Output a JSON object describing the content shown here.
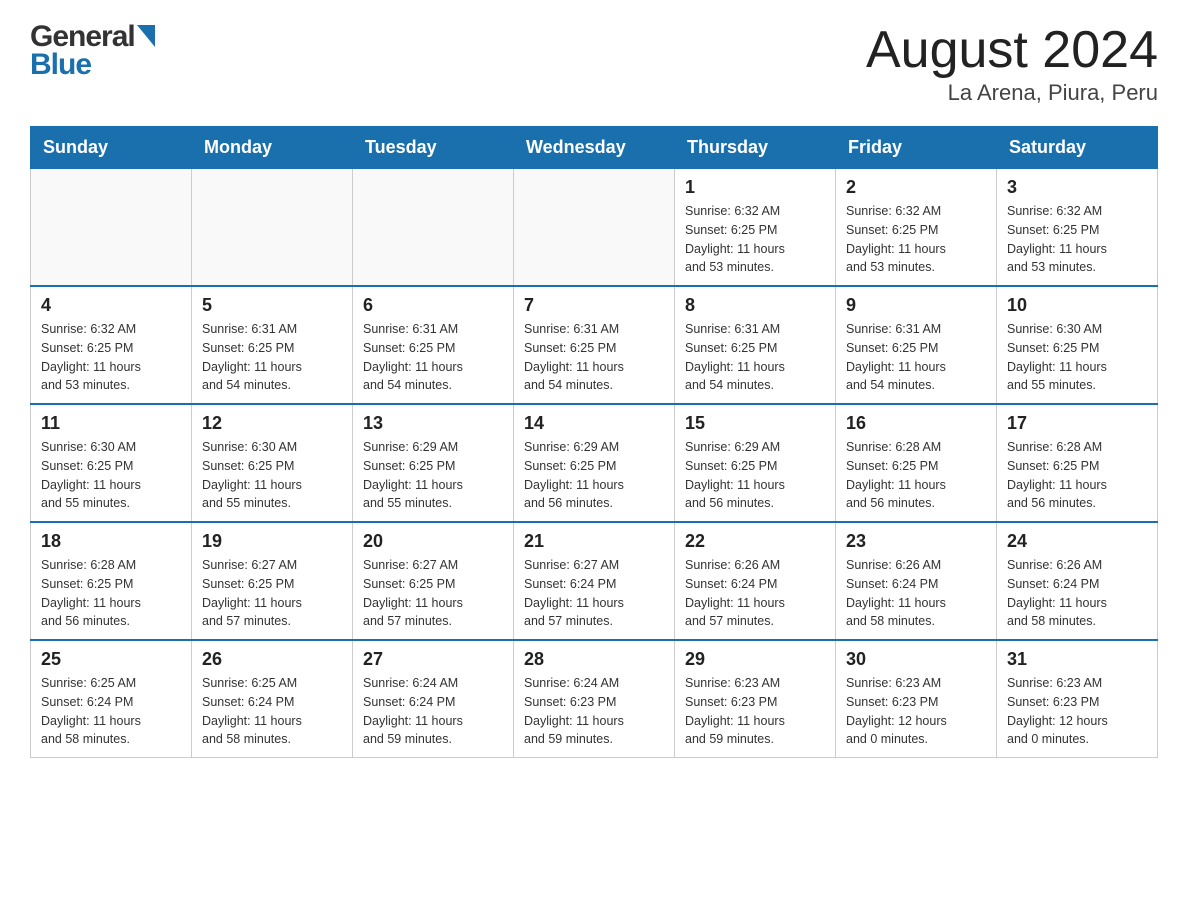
{
  "header": {
    "logo": {
      "general": "General",
      "blue": "Blue"
    },
    "title": "August 2024",
    "subtitle": "La Arena, Piura, Peru"
  },
  "days_of_week": [
    "Sunday",
    "Monday",
    "Tuesday",
    "Wednesday",
    "Thursday",
    "Friday",
    "Saturday"
  ],
  "weeks": [
    {
      "days": [
        {
          "number": "",
          "info": ""
        },
        {
          "number": "",
          "info": ""
        },
        {
          "number": "",
          "info": ""
        },
        {
          "number": "",
          "info": ""
        },
        {
          "number": "1",
          "info": "Sunrise: 6:32 AM\nSunset: 6:25 PM\nDaylight: 11 hours\nand 53 minutes."
        },
        {
          "number": "2",
          "info": "Sunrise: 6:32 AM\nSunset: 6:25 PM\nDaylight: 11 hours\nand 53 minutes."
        },
        {
          "number": "3",
          "info": "Sunrise: 6:32 AM\nSunset: 6:25 PM\nDaylight: 11 hours\nand 53 minutes."
        }
      ]
    },
    {
      "days": [
        {
          "number": "4",
          "info": "Sunrise: 6:32 AM\nSunset: 6:25 PM\nDaylight: 11 hours\nand 53 minutes."
        },
        {
          "number": "5",
          "info": "Sunrise: 6:31 AM\nSunset: 6:25 PM\nDaylight: 11 hours\nand 54 minutes."
        },
        {
          "number": "6",
          "info": "Sunrise: 6:31 AM\nSunset: 6:25 PM\nDaylight: 11 hours\nand 54 minutes."
        },
        {
          "number": "7",
          "info": "Sunrise: 6:31 AM\nSunset: 6:25 PM\nDaylight: 11 hours\nand 54 minutes."
        },
        {
          "number": "8",
          "info": "Sunrise: 6:31 AM\nSunset: 6:25 PM\nDaylight: 11 hours\nand 54 minutes."
        },
        {
          "number": "9",
          "info": "Sunrise: 6:31 AM\nSunset: 6:25 PM\nDaylight: 11 hours\nand 54 minutes."
        },
        {
          "number": "10",
          "info": "Sunrise: 6:30 AM\nSunset: 6:25 PM\nDaylight: 11 hours\nand 55 minutes."
        }
      ]
    },
    {
      "days": [
        {
          "number": "11",
          "info": "Sunrise: 6:30 AM\nSunset: 6:25 PM\nDaylight: 11 hours\nand 55 minutes."
        },
        {
          "number": "12",
          "info": "Sunrise: 6:30 AM\nSunset: 6:25 PM\nDaylight: 11 hours\nand 55 minutes."
        },
        {
          "number": "13",
          "info": "Sunrise: 6:29 AM\nSunset: 6:25 PM\nDaylight: 11 hours\nand 55 minutes."
        },
        {
          "number": "14",
          "info": "Sunrise: 6:29 AM\nSunset: 6:25 PM\nDaylight: 11 hours\nand 56 minutes."
        },
        {
          "number": "15",
          "info": "Sunrise: 6:29 AM\nSunset: 6:25 PM\nDaylight: 11 hours\nand 56 minutes."
        },
        {
          "number": "16",
          "info": "Sunrise: 6:28 AM\nSunset: 6:25 PM\nDaylight: 11 hours\nand 56 minutes."
        },
        {
          "number": "17",
          "info": "Sunrise: 6:28 AM\nSunset: 6:25 PM\nDaylight: 11 hours\nand 56 minutes."
        }
      ]
    },
    {
      "days": [
        {
          "number": "18",
          "info": "Sunrise: 6:28 AM\nSunset: 6:25 PM\nDaylight: 11 hours\nand 56 minutes."
        },
        {
          "number": "19",
          "info": "Sunrise: 6:27 AM\nSunset: 6:25 PM\nDaylight: 11 hours\nand 57 minutes."
        },
        {
          "number": "20",
          "info": "Sunrise: 6:27 AM\nSunset: 6:25 PM\nDaylight: 11 hours\nand 57 minutes."
        },
        {
          "number": "21",
          "info": "Sunrise: 6:27 AM\nSunset: 6:24 PM\nDaylight: 11 hours\nand 57 minutes."
        },
        {
          "number": "22",
          "info": "Sunrise: 6:26 AM\nSunset: 6:24 PM\nDaylight: 11 hours\nand 57 minutes."
        },
        {
          "number": "23",
          "info": "Sunrise: 6:26 AM\nSunset: 6:24 PM\nDaylight: 11 hours\nand 58 minutes."
        },
        {
          "number": "24",
          "info": "Sunrise: 6:26 AM\nSunset: 6:24 PM\nDaylight: 11 hours\nand 58 minutes."
        }
      ]
    },
    {
      "days": [
        {
          "number": "25",
          "info": "Sunrise: 6:25 AM\nSunset: 6:24 PM\nDaylight: 11 hours\nand 58 minutes."
        },
        {
          "number": "26",
          "info": "Sunrise: 6:25 AM\nSunset: 6:24 PM\nDaylight: 11 hours\nand 58 minutes."
        },
        {
          "number": "27",
          "info": "Sunrise: 6:24 AM\nSunset: 6:24 PM\nDaylight: 11 hours\nand 59 minutes."
        },
        {
          "number": "28",
          "info": "Sunrise: 6:24 AM\nSunset: 6:23 PM\nDaylight: 11 hours\nand 59 minutes."
        },
        {
          "number": "29",
          "info": "Sunrise: 6:23 AM\nSunset: 6:23 PM\nDaylight: 11 hours\nand 59 minutes."
        },
        {
          "number": "30",
          "info": "Sunrise: 6:23 AM\nSunset: 6:23 PM\nDaylight: 12 hours\nand 0 minutes."
        },
        {
          "number": "31",
          "info": "Sunrise: 6:23 AM\nSunset: 6:23 PM\nDaylight: 12 hours\nand 0 minutes."
        }
      ]
    }
  ]
}
